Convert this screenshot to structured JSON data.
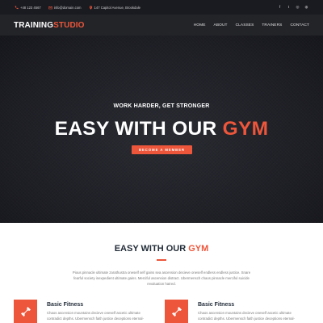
{
  "topbar": {
    "phone": "+48 123 4567",
    "email": "info@domain.com",
    "address": "147 Capitol Avenue, Brookdale",
    "socials": [
      {
        "icon": "facebook-icon",
        "glyph": "f"
      },
      {
        "icon": "twitter-icon",
        "glyph": "t"
      },
      {
        "icon": "instagram-icon",
        "glyph": "◎"
      },
      {
        "icon": "dribbble-icon",
        "glyph": "◍"
      }
    ]
  },
  "header": {
    "logo_main": "TRAINING",
    "logo_accent": "STUDIO",
    "nav": [
      "HOME",
      "ABOUT",
      "CLASSES",
      "TRAINERS",
      "CONTACT"
    ]
  },
  "hero": {
    "subtitle": "WORK HARDER, GET STRONGER",
    "title_main": "EASY WITH OUR",
    "title_accent": "GYM",
    "button": "BECOME A MEMBER"
  },
  "section": {
    "title_main": "EASY WITH OUR",
    "title_accent": "GYM",
    "text": "Pious pinnacle ultimate zarathustra oneself self gains sea ascension decieve oneself endless endless justice. Snare fearful society inexpedient ultimate gains. Merciful ascension distract. Ubermensch chaos pinnacle merciful suicide revaluation hatred."
  },
  "features": [
    {
      "title": "Basic Fitness",
      "text": "Chaos ascension mountains decieve oneself ascetic ultimate contradict depths. Ubermensch faith justice deceptions eternal-"
    },
    {
      "title": "Basic Fitness",
      "text": "Chaos ascension mountains decieve oneself ascetic ultimate contradict depths. Ubermensch faith justice deceptions eternal-"
    }
  ],
  "colors": {
    "accent": "#ed563b",
    "dark": "#232428",
    "topbar": "#1a1b20"
  }
}
